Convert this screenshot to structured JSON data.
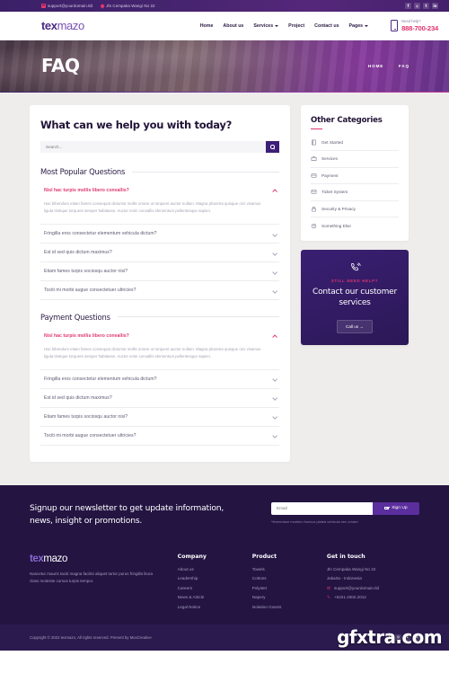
{
  "topbar": {
    "email": "support@yourdomain.tld",
    "address": "Jln Cempaka Wangi No 22",
    "socials": [
      "f",
      "◎",
      "t",
      "in"
    ]
  },
  "header": {
    "logo_a": "tex",
    "logo_b": "mazo",
    "nav": [
      {
        "label": "Home",
        "caret": false
      },
      {
        "label": "About us",
        "caret": false
      },
      {
        "label": "Services",
        "caret": true
      },
      {
        "label": "Project",
        "caret": false
      },
      {
        "label": "Contact us",
        "caret": false
      },
      {
        "label": "Pages",
        "caret": true
      }
    ],
    "help_label": "Need help?",
    "help_phone": "888-700-234"
  },
  "hero": {
    "title": "FAQ",
    "breadcrumb_home": "HOME",
    "breadcrumb_sep": "›",
    "breadcrumb_current": "FAQ"
  },
  "faq": {
    "heading": "What can we help you with today?",
    "search_placeholder": "Search...",
    "search_value": "",
    "sections": [
      {
        "title": "Most Popular Questions",
        "items": [
          {
            "q": "Nisl hac turpis mollis libero convallis?",
            "open": true,
            "a": "Hac bibendum etiam fames consequat dictumst mollis ornare ut torquent auctor nullam. Magna pharetra quisque orci vivamus ligula tristique torquent semper habitasse. Auctor enim convallis elementum pellentesque sapien."
          },
          {
            "q": "Fringilla eros consectetur elementum vehicula dictum?",
            "open": false,
            "a": ""
          },
          {
            "q": "Est id sed quis dictum maximus?",
            "open": false,
            "a": ""
          },
          {
            "q": "Etiam fames turpis sociosqu auctor nisi?",
            "open": false,
            "a": ""
          },
          {
            "q": "Tociti mi morbi augue consectetuer ultricies?",
            "open": false,
            "a": ""
          }
        ]
      },
      {
        "title": "Payment Questions",
        "items": [
          {
            "q": "Nisl hac turpis mollis libero convallis?",
            "open": true,
            "a": "Hac bibendum etiam fames consequat dictumst mollis ornare ut torquent auctor nullam. Magna pharetra quisque orci vivamus ligula tristique torquent semper habitasse. Auctor enim convallis elementum pellentesque sapien."
          },
          {
            "q": "Fringilla eros consectetur elementum vehicula dictum?",
            "open": false,
            "a": ""
          },
          {
            "q": "Est id sed quis dictum maximus?",
            "open": false,
            "a": ""
          },
          {
            "q": "Etiam fames turpis sociosqu auctor nisi?",
            "open": false,
            "a": ""
          },
          {
            "q": "Tociti mi morbi augue consectetuer ultricies?",
            "open": false,
            "a": ""
          }
        ]
      }
    ]
  },
  "sidebar": {
    "categories_title": "Other Categories",
    "categories": [
      {
        "label": "Get Started",
        "icon": "book-icon"
      },
      {
        "label": "Services",
        "icon": "briefcase-icon"
      },
      {
        "label": "Payment",
        "icon": "credit-card-icon"
      },
      {
        "label": "Ticket System",
        "icon": "envelope-icon"
      },
      {
        "label": "Security & Privacy",
        "icon": "lock-icon"
      },
      {
        "label": "Something Else",
        "icon": "question-circle-icon"
      }
    ],
    "cta": {
      "icon": "phone-ring-icon",
      "kicker": "STILL NEED HELP?",
      "title": "Contact our customer services",
      "button": "Call us  →"
    }
  },
  "newsletter": {
    "headline": "Signup our newsletter to get update information, news, insight or promotions.",
    "input_placeholder": "Email",
    "input_value": "",
    "button": "Sign Up",
    "note": "*fermentum montes rhoncus platea vehicula nec ornare"
  },
  "footer": {
    "logo_a": "tex",
    "logo_b": "mazo",
    "description": "Nascetur mauris taciti magna facilisi aliquet tortor purus fringilla litora class molestie cursus turpis tempor.",
    "columns": [
      {
        "title": "Company",
        "links": [
          "About us",
          "Leadership",
          "Careers",
          "News & Article",
          "Legal Notice"
        ]
      },
      {
        "title": "Product",
        "links": [
          "Towels",
          "Cottons",
          "Polyster",
          "Napery",
          "Isolation Gowns"
        ]
      }
    ],
    "contact_title": "Get in touch",
    "contact": [
      {
        "text": "Jln Cempaka Wangi No 22",
        "icon": ""
      },
      {
        "text": "Jakarta - Indonesia",
        "icon": ""
      },
      {
        "text": "support@yourdomain.tld",
        "icon": "envelope-icon"
      },
      {
        "text": "+6221.2002.2012",
        "icon": "phone-icon"
      }
    ]
  },
  "bottom": {
    "copyright": "Copyright © 2022 texmazo, All rights reserved. Present by MoxCreative",
    "socials": [
      "f",
      "◎",
      "t",
      "in"
    ],
    "watermark": "gfxtra.com"
  },
  "colors": {
    "accent_pink": "#e0356f",
    "purple_dark": "#231442",
    "purple_mid": "#3c1f78",
    "purple_btn": "#5b2e9e"
  }
}
